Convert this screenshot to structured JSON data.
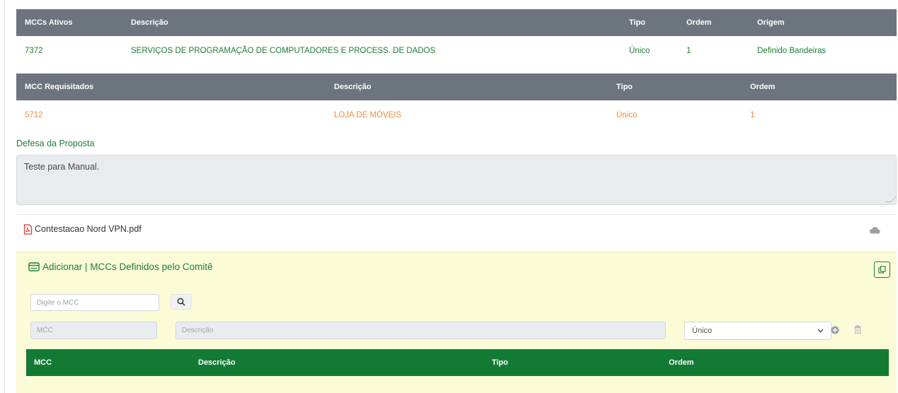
{
  "mcc_ativos": {
    "headers": [
      "MCCs Ativos",
      "Descrição",
      "Tipo",
      "Ordem",
      "Origem"
    ],
    "rows": [
      {
        "mcc": "7372",
        "descricao": "SERVIÇOS DE PROGRAMAÇÃO DE COMPUTADORES E PROCESS. DE DADOS",
        "tipo": "Único",
        "ordem": "1",
        "origem": "Definido Bandeiras"
      }
    ]
  },
  "mcc_requisitados": {
    "headers": [
      "MCC Requisitados",
      "Descrição",
      "Tipo",
      "Ordem"
    ],
    "rows": [
      {
        "mcc": "5712",
        "descricao": "LOJA DE MÓVEIS",
        "tipo": "Único",
        "ordem": "1"
      }
    ]
  },
  "defesa": {
    "label": "Defesa da Proposta",
    "value": "Teste para Manual."
  },
  "attachment": {
    "filename": "Contestacao Nord VPN.pdf"
  },
  "comite_panel": {
    "title": "Adicionar | MCCs Definidos pelo Comitê",
    "search_placeholder": "Digite o MCC",
    "mcc_placeholder": "MCC",
    "descricao_placeholder": "Descrição",
    "tipo_selected": "Único",
    "table_headers": [
      "MCC",
      "Descrição",
      "Tipo",
      "Ordem"
    ]
  },
  "colors": {
    "header_gray": "#6c757d",
    "accent_green": "#1e7e34",
    "table_green": "#137a36",
    "requested_orange": "#f28c40",
    "panel_yellow": "#fbfbd8"
  }
}
